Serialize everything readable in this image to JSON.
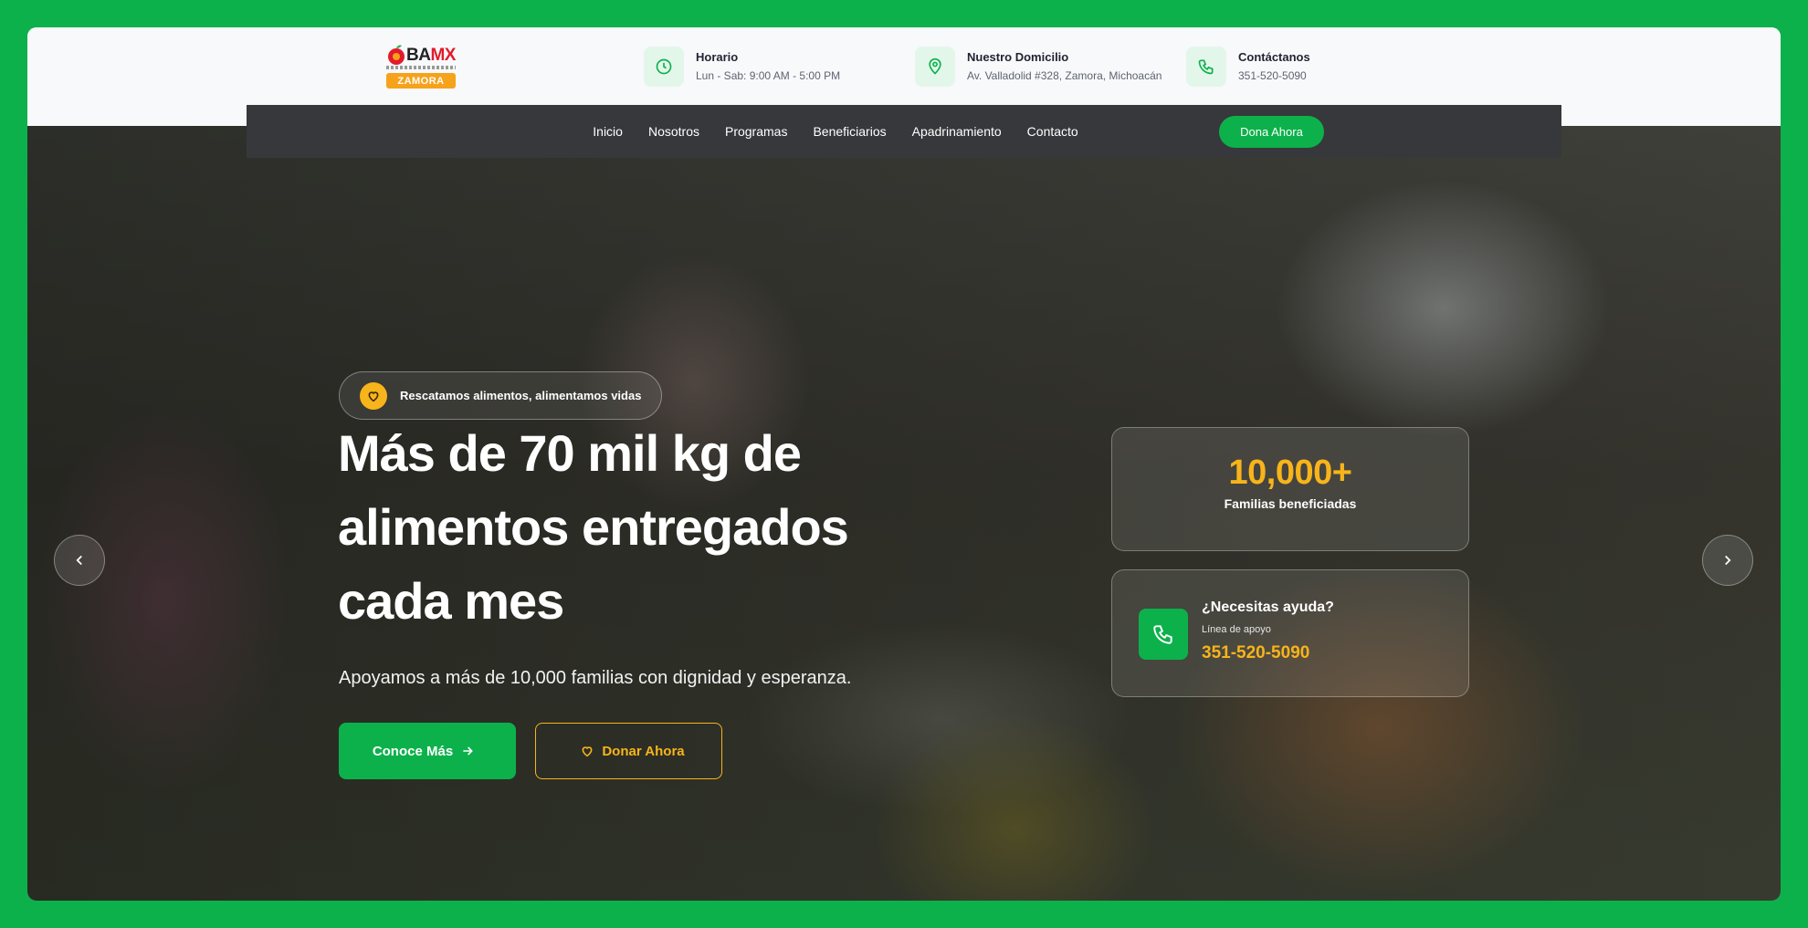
{
  "logo": {
    "name": "BAMX",
    "name_b": "BA",
    "name_mx": "MX",
    "badge": "ZAMORA"
  },
  "info": [
    {
      "title": "Horario",
      "text": "Lun - Sab: 9:00 AM - 5:00 PM",
      "icon": "clock-icon"
    },
    {
      "title": "Nuestro Domicilio",
      "text": "Av. Valladolid #328, Zamora, Michoacán",
      "icon": "map-pin-icon"
    },
    {
      "title": "Contáctanos",
      "text": "351-520-5090",
      "icon": "phone-icon"
    }
  ],
  "nav": {
    "links": [
      "Inicio",
      "Nosotros",
      "Programas",
      "Beneficiarios",
      "Apadrinamiento",
      "Contacto"
    ],
    "cta": "Dona Ahora"
  },
  "hero": {
    "tagline": "Rescatamos alimentos, alimentamos vidas",
    "headline_line1": "Más de 70 mil kg de",
    "headline_line2": "alimentos entregados",
    "headline_line3": "cada mes",
    "subheadline": "Apoyamos a más de 10,000 familias con dignidad y esperanza.",
    "primary_button": "Conoce Más",
    "secondary_button": "Donar Ahora"
  },
  "stats": {
    "number": "10,000+",
    "label": "Familias beneficiadas"
  },
  "help": {
    "title": "¿Necesitas ayuda?",
    "subtitle": "Línea de apoyo",
    "phone": "351-520-5090"
  },
  "colors": {
    "brand_green": "#0db14b",
    "accent_yellow": "#f7b41b",
    "nav_bg": "#36383b",
    "page_bg": "#0db14b"
  }
}
